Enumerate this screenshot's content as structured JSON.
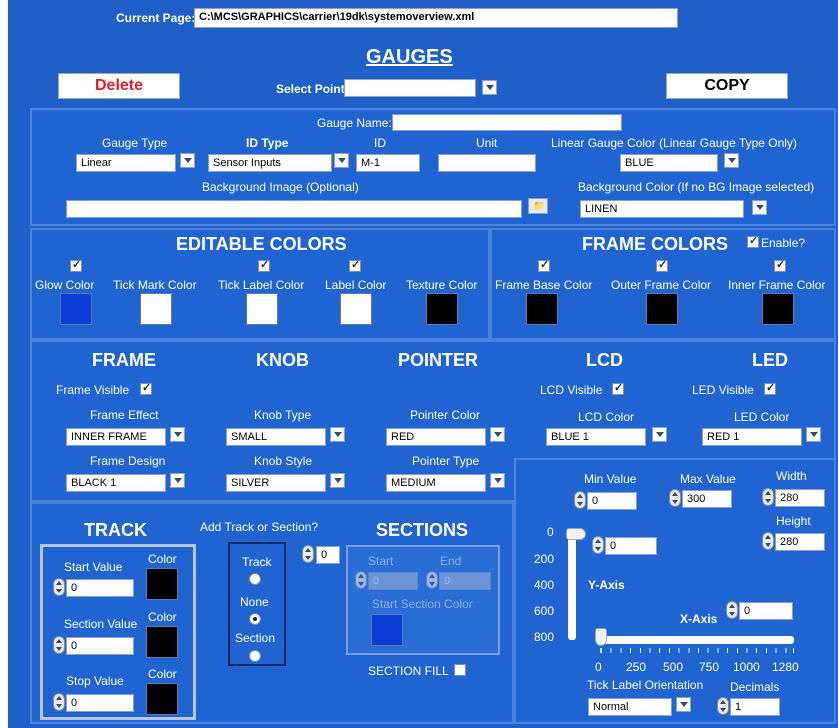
{
  "header": {
    "current_page_label": "Current Page:",
    "current_page_path": "C:\\MCS\\GRAPHICS\\carrier\\19dk\\systemoverview.xml",
    "title": "GAUGES",
    "delete_label": "Delete",
    "copy_label": "COPY",
    "select_point_label": "Select Point:",
    "select_point_value": ""
  },
  "general": {
    "gauge_name_label": "Gauge Name:",
    "gauge_name_value": "",
    "gauge_type_label": "Gauge Type",
    "gauge_type_value": "Linear",
    "id_type_label": "ID Type",
    "id_type_value": "Sensor Inputs",
    "id_label": "ID",
    "id_value": "M-1",
    "unit_label": "Unit",
    "unit_value": "",
    "linear_color_label": "Linear Gauge Color (Linear Gauge Type Only)",
    "linear_color_value": "BLUE",
    "bg_image_label": "Background Image (Optional)",
    "bg_image_value": "",
    "bg_color_label": "Background Color (If no BG Image selected)",
    "bg_color_value": "LINEN"
  },
  "editable_colors": {
    "title": "EDITABLE COLORS",
    "items": [
      {
        "label": "Glow Color",
        "color": "#0a3fd6",
        "checked": true
      },
      {
        "label": "Tick Mark Color",
        "color": "#ffffff",
        "checked": false
      },
      {
        "label": "Tick Label Color",
        "color": "#ffffff",
        "checked": true
      },
      {
        "label": "Label Color",
        "color": "#ffffff",
        "checked": true
      },
      {
        "label": "Texture Color",
        "color": "#000000",
        "checked": false
      }
    ]
  },
  "frame_colors": {
    "title": "FRAME COLORS",
    "enable_label": "Enable?",
    "items": [
      {
        "label": "Frame Base Color",
        "color": "#000000",
        "checked": true
      },
      {
        "label": "Outer Frame Color",
        "color": "#000000",
        "checked": true
      },
      {
        "label": "Inner Frame Color",
        "color": "#000000",
        "checked": true
      }
    ]
  },
  "frame": {
    "title": "FRAME",
    "visible_label": "Frame Visible",
    "effect_label": "Frame Effect",
    "effect_value": "INNER FRAME",
    "design_label": "Frame Design",
    "design_value": "BLACK 1"
  },
  "knob": {
    "title": "KNOB",
    "type_label": "Knob Type",
    "type_value": "SMALL",
    "style_label": "Knob Style",
    "style_value": "SILVER"
  },
  "pointer": {
    "title": "POINTER",
    "color_label": "Pointer Color",
    "color_value": "RED",
    "type_label": "Pointer Type",
    "type_value": "MEDIUM"
  },
  "lcd": {
    "title": "LCD",
    "visible_label": "LCD Visible",
    "color_label": "LCD Color",
    "color_value": "BLUE 1"
  },
  "led": {
    "title": "LED",
    "visible_label": "LED Visible",
    "color_label": "LED Color",
    "color_value": "RED 1"
  },
  "track": {
    "title": "TRACK",
    "start_label": "Start Value",
    "start_value": "0",
    "section_label": "Section Value",
    "section_value": "0",
    "stop_label": "Stop Value",
    "stop_value": "0",
    "color_label": "Color",
    "track_color": "#000000"
  },
  "add": {
    "label": "Add Track or Section?",
    "track_label": "Track",
    "none_label": "None",
    "section_label": "Section",
    "count_value": "0"
  },
  "sections": {
    "title": "SECTIONS",
    "start_label": "Start",
    "end_label": "End",
    "start_value": "0",
    "end_value": "0",
    "color_label": "Start Section Color",
    "color": "#0a3fd6",
    "fill_label": "SECTION FILL"
  },
  "scale": {
    "min_label": "Min Value",
    "min_value": "0",
    "max_label": "Max Value",
    "max_value": "300",
    "width_label": "Width",
    "width_value": "280",
    "height_label": "Height",
    "height_value": "280",
    "yaxis_label": "Y-Axis",
    "yaxis_value": "0",
    "xaxis_label": "X-Axis",
    "xaxis_value": "0",
    "y_ticks": [
      "0",
      "200",
      "400",
      "600",
      "800"
    ],
    "x_ticks": [
      "0",
      "250",
      "500",
      "750",
      "1000",
      "1280"
    ],
    "orientation_label": "Tick Label Orientation",
    "orientation_value": "Normal",
    "decimals_label": "Decimals",
    "decimals_value": "1"
  }
}
